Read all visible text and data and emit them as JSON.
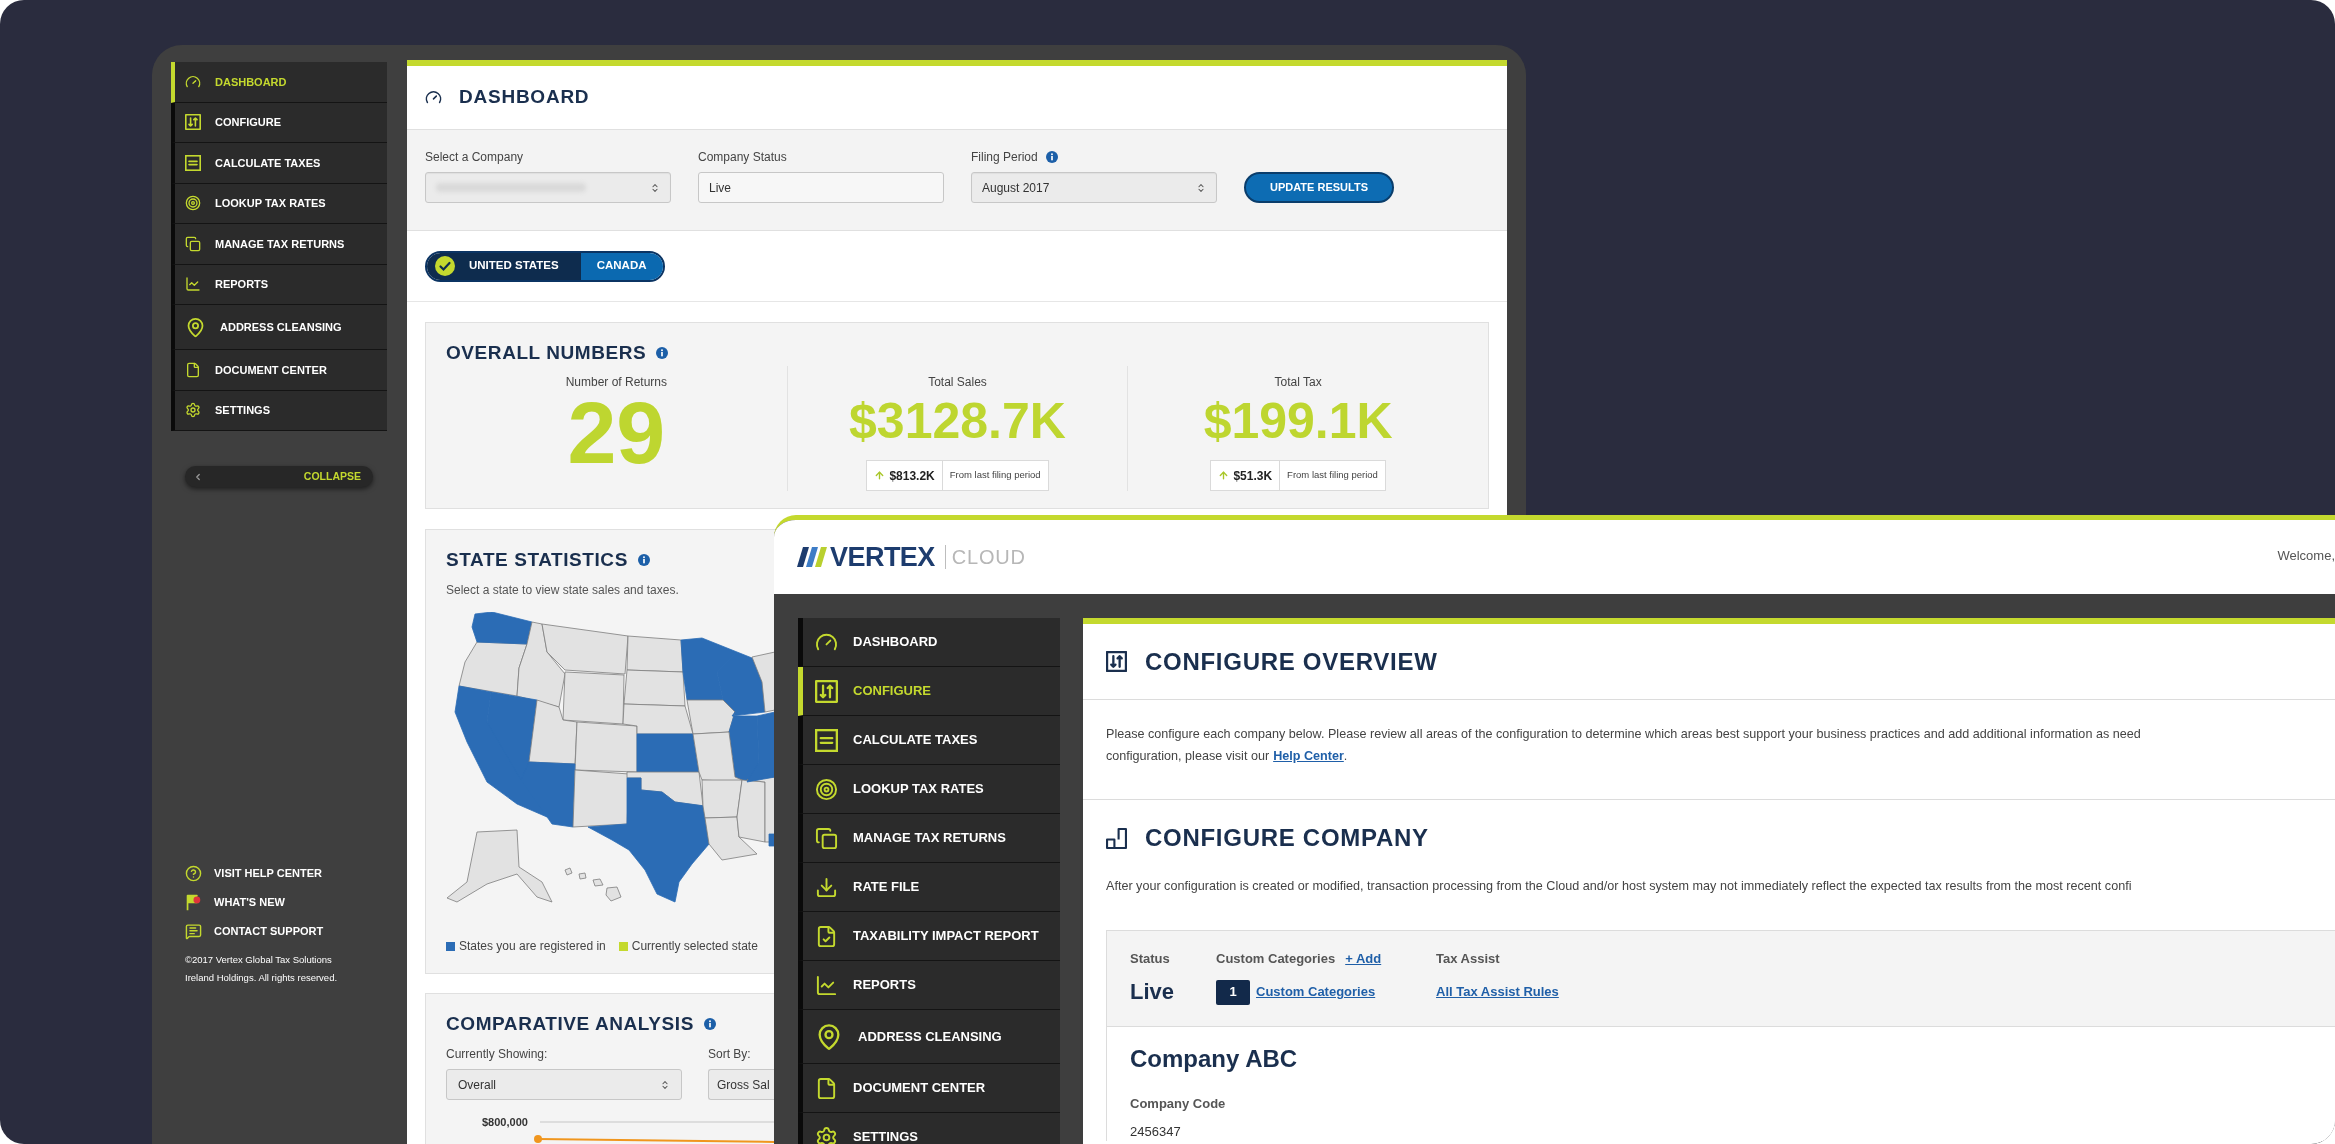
{
  "back_window": {
    "sidebar": {
      "items": [
        {
          "label": "DASHBOARD",
          "selected": true
        },
        {
          "label": "CONFIGURE",
          "selected": false
        },
        {
          "label": "CALCULATE TAXES",
          "selected": false
        },
        {
          "label": "LOOKUP TAX RATES",
          "selected": false
        },
        {
          "label": "MANAGE TAX RETURNS",
          "selected": false
        },
        {
          "label": "REPORTS",
          "selected": false
        },
        {
          "label": "ADDRESS CLEANSING",
          "selected": false
        },
        {
          "label": "DOCUMENT CENTER",
          "selected": false
        },
        {
          "label": "SETTINGS",
          "selected": false
        }
      ],
      "collapse_label": "COLLAPSE",
      "footer_links": [
        "VISIT HELP CENTER",
        "WHAT'S NEW",
        "CONTACT SUPPORT"
      ],
      "copyright": "©2017 Vertex Global Tax Solutions Ireland Holdings. All rights reserved."
    },
    "page_title": "DASHBOARD",
    "filters": [
      {
        "kind": "select",
        "label": "Select a Company",
        "info": false,
        "redacted": true
      },
      {
        "kind": "input",
        "label": "Company Status",
        "info": false,
        "redacted": false,
        "value": "Live"
      },
      {
        "kind": "select",
        "label": "Filing Period",
        "info": true,
        "redacted": false,
        "value": "August 2017"
      }
    ],
    "update_button": "UPDATE RESULTS",
    "country_toggle": [
      {
        "label": "UNITED STATES",
        "selected": true
      },
      {
        "label": "CANADA",
        "selected": false
      }
    ],
    "overall_numbers": {
      "title": "OVERALL NUMBERS",
      "metrics": [
        {
          "label": "Number of Returns",
          "value": "29"
        },
        {
          "label": "Total Sales",
          "value": "$3128.7K",
          "change": "$813.2K",
          "change_note": "From last filing period"
        },
        {
          "label": "Total Tax",
          "value": "$199.1K",
          "change": "$51.3K",
          "change_note": "From last filing period"
        }
      ]
    },
    "state_statistics": {
      "title": "STATE STATISTICS",
      "subtitle": "Select a state to view state sales and taxes.",
      "legend": [
        {
          "label": "States you are registered in",
          "color": "#2b6cb5"
        },
        {
          "label": "Currently selected state",
          "color": "#c4d92e"
        }
      ]
    },
    "comparative_analysis": {
      "title": "COMPARATIVE ANALYSIS",
      "filters": [
        {
          "label": "Currently Showing:",
          "value": "Overall"
        },
        {
          "label": "Sort By:",
          "value": "Gross Sal"
        }
      ],
      "y_tick_label": "$800,000"
    }
  },
  "front_window": {
    "logo": {
      "brand": "VERTEX",
      "product": "CLOUD"
    },
    "welcome": "Welcome,",
    "sidebar": {
      "items": [
        {
          "label": "DASHBOARD",
          "selected": false
        },
        {
          "label": "CONFIGURE",
          "selected": true
        },
        {
          "label": "CALCULATE TAXES",
          "selected": false
        },
        {
          "label": "LOOKUP TAX RATES",
          "selected": false
        },
        {
          "label": "MANAGE TAX RETURNS",
          "selected": false
        },
        {
          "label": "RATE FILE",
          "selected": false
        },
        {
          "label": "TAXABILITY IMPACT REPORT",
          "selected": false
        },
        {
          "label": "REPORTS",
          "selected": false
        },
        {
          "label": "ADDRESS CLEANSING",
          "selected": false
        },
        {
          "label": "DOCUMENT CENTER",
          "selected": false
        },
        {
          "label": "SETTINGS",
          "selected": false
        }
      ]
    },
    "overview": {
      "title": "CONFIGURE OVERVIEW",
      "line_1": "Please configure each company below. Please review all areas of the configuration to determine which areas best support your business practices and add additional information as need",
      "line_2": "configuration, please visit our",
      "link": "Help Center",
      "line_2_end": "."
    },
    "company": {
      "title": "CONFIGURE COMPANY",
      "note": "After your configuration is created or modified, transaction processing from the Cloud and/or host system may not immediately reflect the expected tax results from the most recent confi",
      "summary": {
        "status_label": "Status",
        "status": "Live",
        "categories_label": "Custom Categories",
        "add_link": "+ Add",
        "category_count": "1",
        "categories_link": "Custom Categories",
        "tax_assist_label": "Tax Assist",
        "tax_assist_link": "All Tax Assist Rules"
      },
      "name": "Company ABC",
      "code_label": "Company Code",
      "code": "2456347"
    }
  }
}
